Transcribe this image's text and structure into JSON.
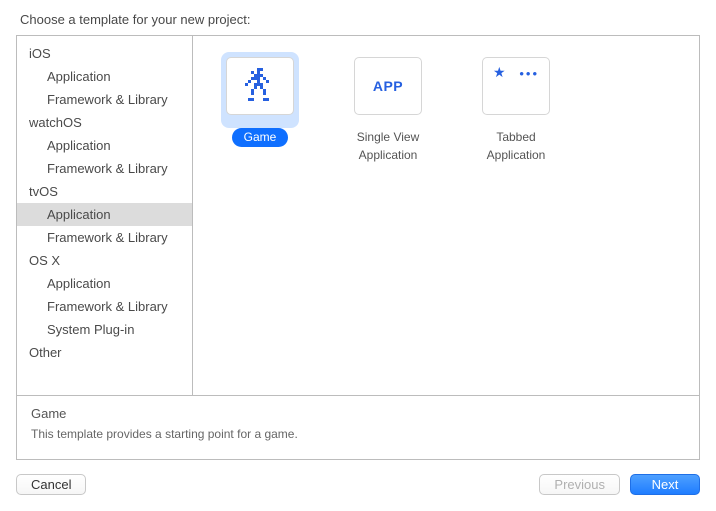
{
  "header": "Choose a template for your new project:",
  "sidebar": {
    "groups": [
      {
        "name": "iOS",
        "items": [
          "Application",
          "Framework & Library"
        ]
      },
      {
        "name": "watchOS",
        "items": [
          "Application",
          "Framework & Library"
        ]
      },
      {
        "name": "tvOS",
        "items": [
          "Application",
          "Framework & Library"
        ]
      },
      {
        "name": "OS X",
        "items": [
          "Application",
          "Framework & Library",
          "System Plug-in"
        ]
      },
      {
        "name": "Other",
        "items": []
      }
    ],
    "selected": "tvOS/Application"
  },
  "templates": [
    {
      "label_line1": "Game",
      "label_line2": "",
      "icon": "game-sprite-icon",
      "selected": true
    },
    {
      "label_line1": "Single View",
      "label_line2": "Application",
      "icon": "app-text-icon",
      "icon_text": "APP",
      "selected": false
    },
    {
      "label_line1": "Tabbed",
      "label_line2": "Application",
      "icon": "tabbed-top-icon",
      "selected": false
    }
  ],
  "description": {
    "title": "Game",
    "text": "This template provides a starting point for a game."
  },
  "buttons": {
    "cancel": "Cancel",
    "previous": "Previous",
    "next": "Next"
  }
}
